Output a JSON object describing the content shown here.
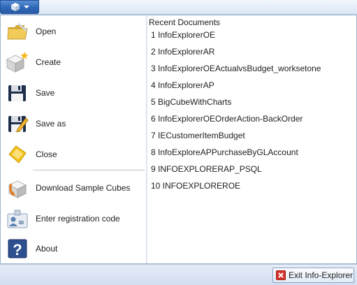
{
  "menu": {
    "items": [
      {
        "label": "Open",
        "icon": "folder-open-icon"
      },
      {
        "label": "Create",
        "icon": "create-cube-icon"
      },
      {
        "label": "Save",
        "icon": "floppy-disk-icon"
      },
      {
        "label": "Save as",
        "icon": "save-as-icon"
      },
      {
        "label": "Close",
        "icon": "close-document-icon"
      },
      {
        "label": "Download Sample Cubes",
        "icon": "download-cube-icon"
      },
      {
        "label": "Enter registration code",
        "icon": "id-card-icon"
      },
      {
        "label": "About",
        "icon": "help-icon"
      }
    ]
  },
  "recent": {
    "title": "Recent Documents",
    "items": [
      "1 InfoExplorerOE",
      "2 InfoExplorerAR",
      "3 InfoExplorerOEActualvsBudget_worksetone",
      "4 InfoExplorerAP",
      "5 BigCubeWithCharts",
      "6 InfoExplorerOEOrderAction-BackOrder",
      "7 IECustomerItemBudget",
      "8 InfoExploreAPPurchaseByGLAccount",
      "9 INFOEXPLORERAP_PSQL",
      "10 INFOEXPLOREROE"
    ]
  },
  "footer": {
    "exit_label": "Exit Info-Explorer"
  },
  "colors": {
    "accent": "#2f67b7",
    "background": "#dfe8f5"
  }
}
